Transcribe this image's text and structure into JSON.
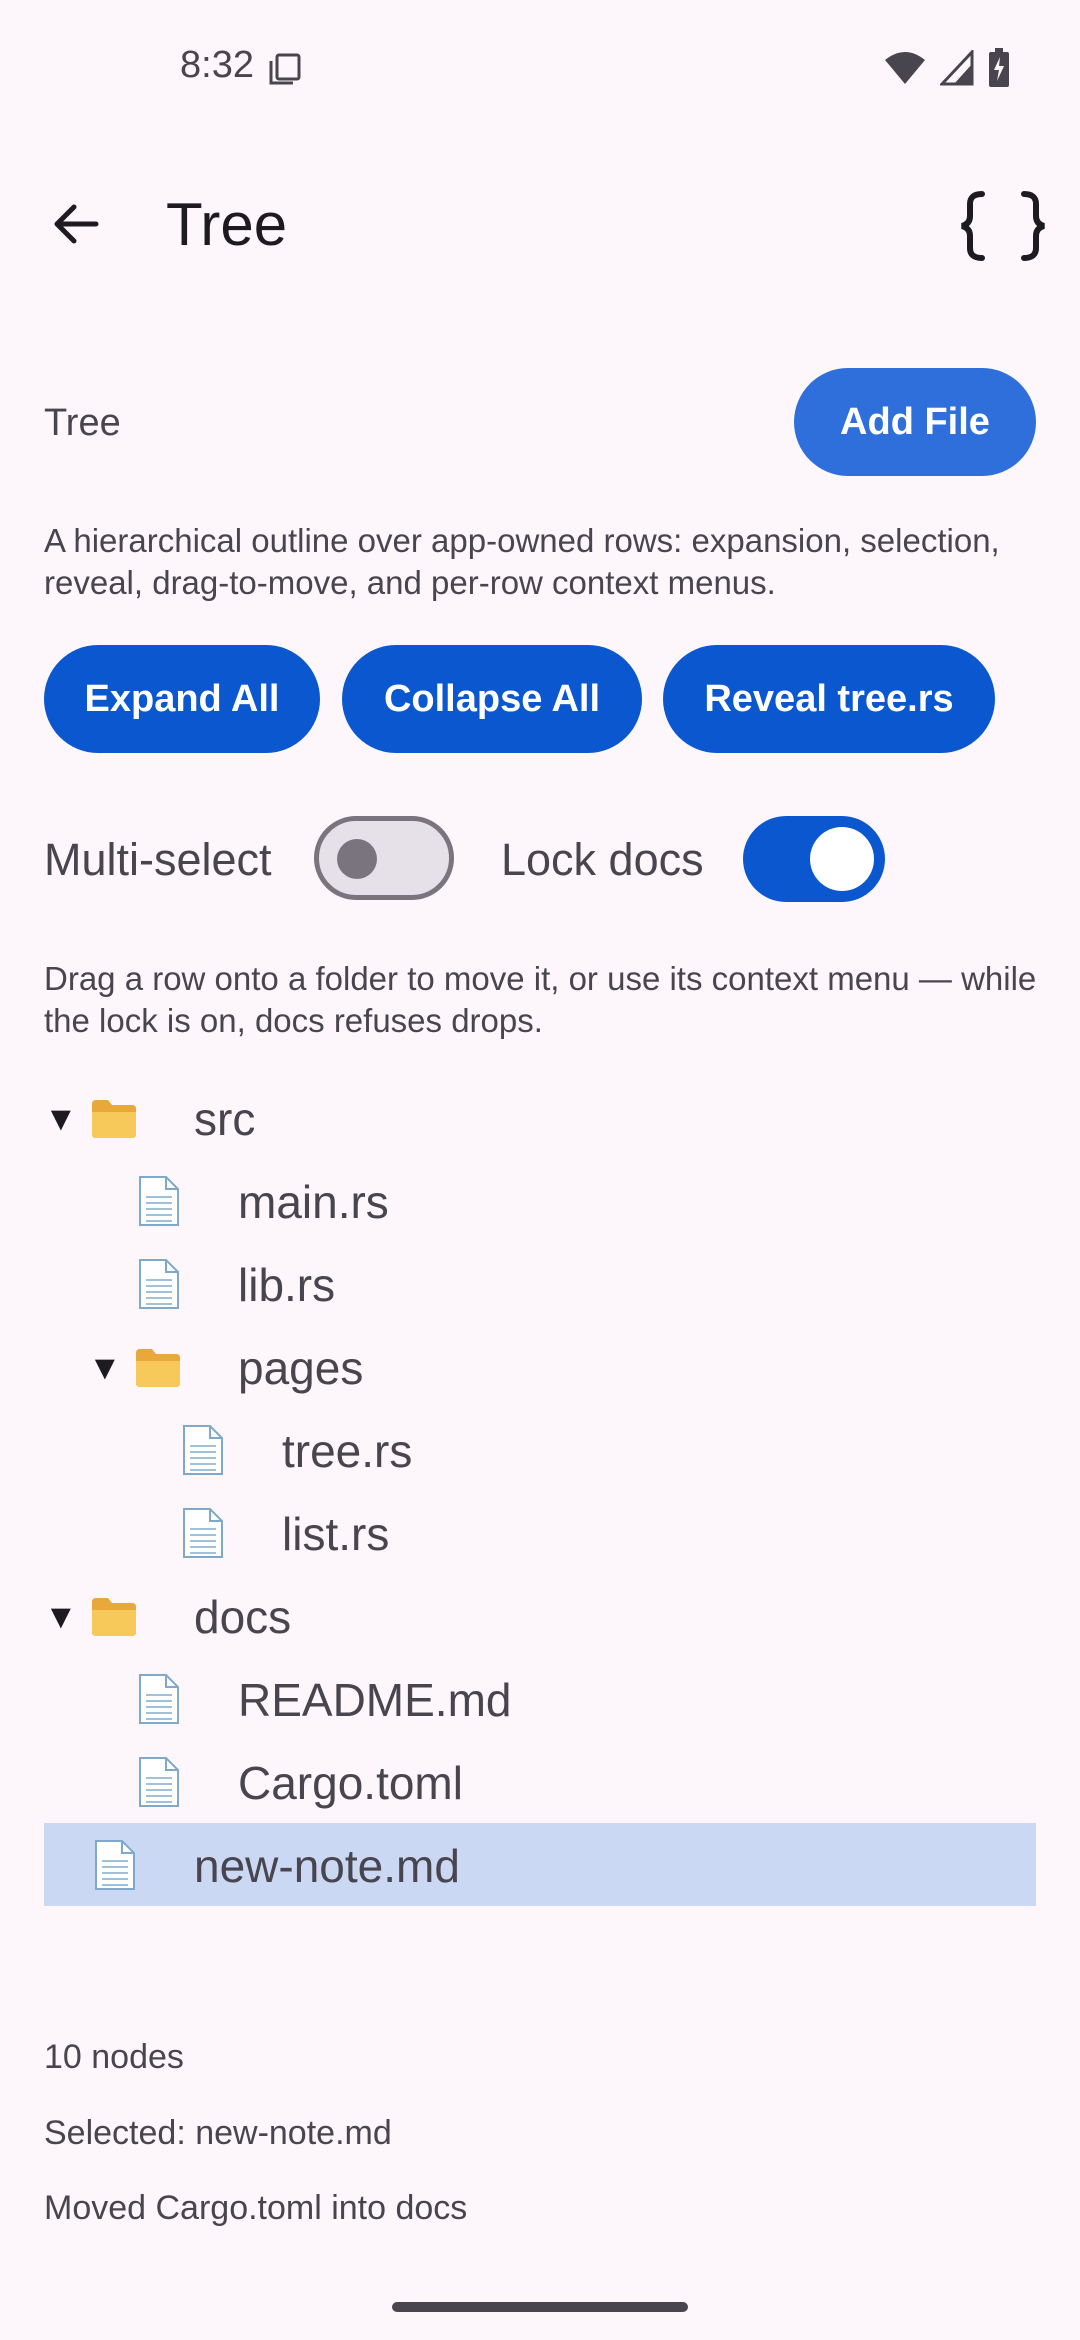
{
  "status": {
    "time": "8:32"
  },
  "appbar": {
    "title": "Tree"
  },
  "section": {
    "title": "Tree",
    "add_file": "Add File",
    "description": "A hierarchical outline over app-owned rows: expansion, selection, reveal, drag-to-move, and per-row context menus.",
    "expand_all": "Expand All",
    "collapse_all": "Collapse All",
    "reveal": "Reveal tree.rs",
    "multi_select_label": "Multi-select",
    "multi_select_on": false,
    "lock_docs_label": "Lock docs",
    "lock_docs_on": true,
    "hint": "Drag a row onto a folder to move it, or use its context menu — while the lock is on, docs refuses drops."
  },
  "tree": [
    {
      "name": "src",
      "type": "folder",
      "depth": 0,
      "expanded": true,
      "caret": "▼"
    },
    {
      "name": "main.rs",
      "type": "file",
      "depth": 1
    },
    {
      "name": "lib.rs",
      "type": "file",
      "depth": 1
    },
    {
      "name": "pages",
      "type": "folder",
      "depth": 1,
      "expanded": true,
      "caret": "▼"
    },
    {
      "name": "tree.rs",
      "type": "file",
      "depth": 2
    },
    {
      "name": "list.rs",
      "type": "file",
      "depth": 2
    },
    {
      "name": "docs",
      "type": "folder",
      "depth": 0,
      "expanded": true,
      "caret": "▼"
    },
    {
      "name": "README.md",
      "type": "file",
      "depth": 1
    },
    {
      "name": "Cargo.toml",
      "type": "file",
      "depth": 1
    },
    {
      "name": "new-note.md",
      "type": "file",
      "depth": 0,
      "selected": true
    }
  ],
  "footer": {
    "count": "10 nodes",
    "selected": "Selected: new-note.md",
    "last_action": "Moved Cargo.toml into docs"
  },
  "colors": {
    "accent": "#0b57d0",
    "selected_row": "#cbd8f4",
    "background": "#fdf7fc"
  }
}
